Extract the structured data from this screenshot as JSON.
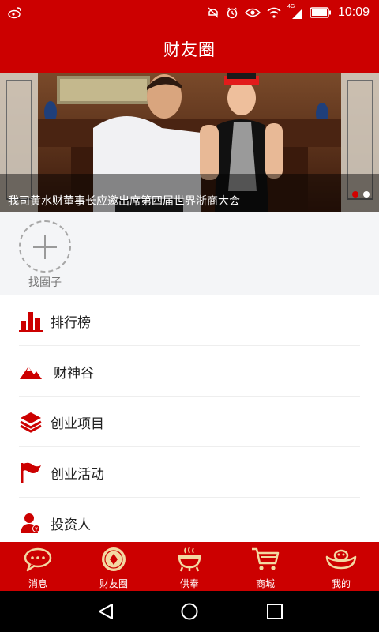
{
  "status_bar": {
    "time": "10:09",
    "network": "4G",
    "icons": [
      "weibo-icon",
      "mute-icon",
      "alarm-icon",
      "eye-icon",
      "wifi-icon",
      "signal-icon",
      "battery-icon"
    ]
  },
  "header": {
    "title": "财友圈"
  },
  "banner": {
    "caption": "我司黄水财董事长应邀出席第四届世界浙商大会",
    "page_count": 2,
    "active_page": 1
  },
  "circles": {
    "add_label": "找圈子"
  },
  "menu": {
    "items": [
      {
        "label": "排行榜",
        "icon": "bar-chart-icon"
      },
      {
        "label": "财神谷",
        "icon": "mountain-icon"
      },
      {
        "label": "创业项目",
        "icon": "layers-icon"
      },
      {
        "label": "创业活动",
        "icon": "flag-icon"
      },
      {
        "label": "投资人",
        "icon": "investor-icon"
      }
    ]
  },
  "tabs": [
    {
      "label": "消息",
      "icon": "chat-bubble-icon",
      "active": false
    },
    {
      "label": "财友圈",
      "icon": "coin-icon",
      "active": true
    },
    {
      "label": "供奉",
      "icon": "incense-burner-icon",
      "active": false
    },
    {
      "label": "商城",
      "icon": "cart-icon",
      "active": false
    },
    {
      "label": "我的",
      "icon": "ingot-icon",
      "active": false
    }
  ],
  "colors": {
    "brand_red": "#cc0000",
    "text_dark": "#222222",
    "text_muted": "#777777",
    "background": "#f4f5f7",
    "tab_icon_gold": "#f3d8a2"
  }
}
